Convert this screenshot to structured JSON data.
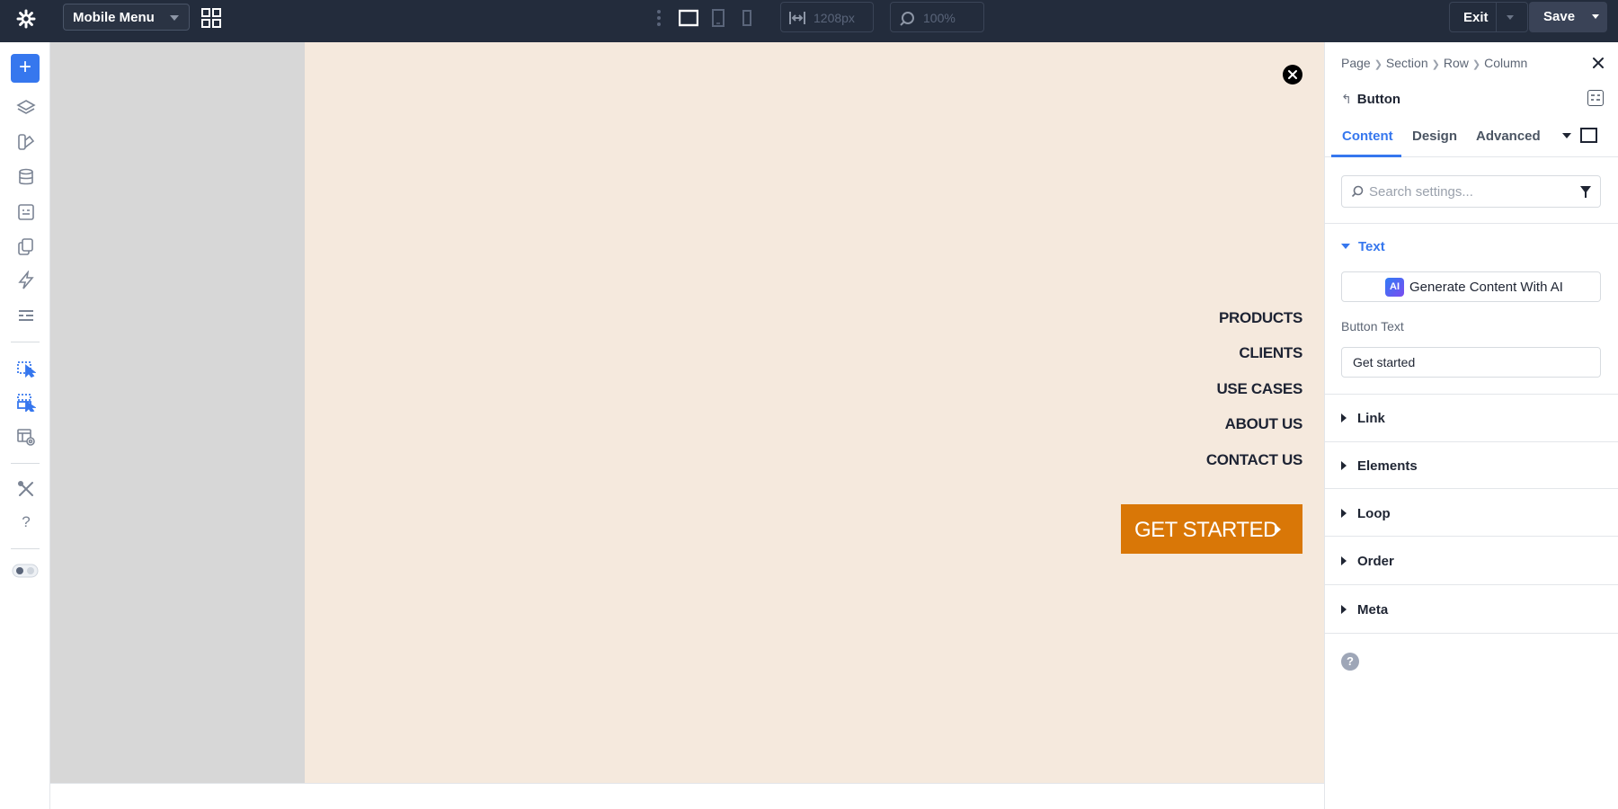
{
  "topbar": {
    "gear_icon": "gear-icon",
    "layout_select": "Mobile Menu",
    "width_value": "1208px",
    "zoom_value": "100%",
    "exit_label": "Exit",
    "save_label": "Save"
  },
  "canvas": {
    "menu_items": [
      "PRODUCTS",
      "CLIENTS",
      "USE CASES",
      "ABOUT US",
      "CONTACT US"
    ],
    "cta_label": "GET STARTED",
    "bg_color": "#f5e9dd",
    "cta_color": "#d97707"
  },
  "panel": {
    "breadcrumb": [
      "Page",
      "Section",
      "Row",
      "Column"
    ],
    "module_title": "Button",
    "tabs": [
      "Content",
      "Design",
      "Advanced"
    ],
    "active_tab": "Content",
    "search_placeholder": "Search settings...",
    "open_section": "Text",
    "ai_button_label": "Generate Content With AI",
    "ai_badge": "AI",
    "button_text_label": "Button Text",
    "button_text_value": "Get started",
    "sections": [
      "Link",
      "Elements",
      "Loop",
      "Order",
      "Meta"
    ],
    "help_label": "?"
  },
  "leftbar": {
    "add_label": "+",
    "help_label": "?"
  },
  "colors": {
    "accent": "#3677ee",
    "topbar": "#232c3c"
  }
}
